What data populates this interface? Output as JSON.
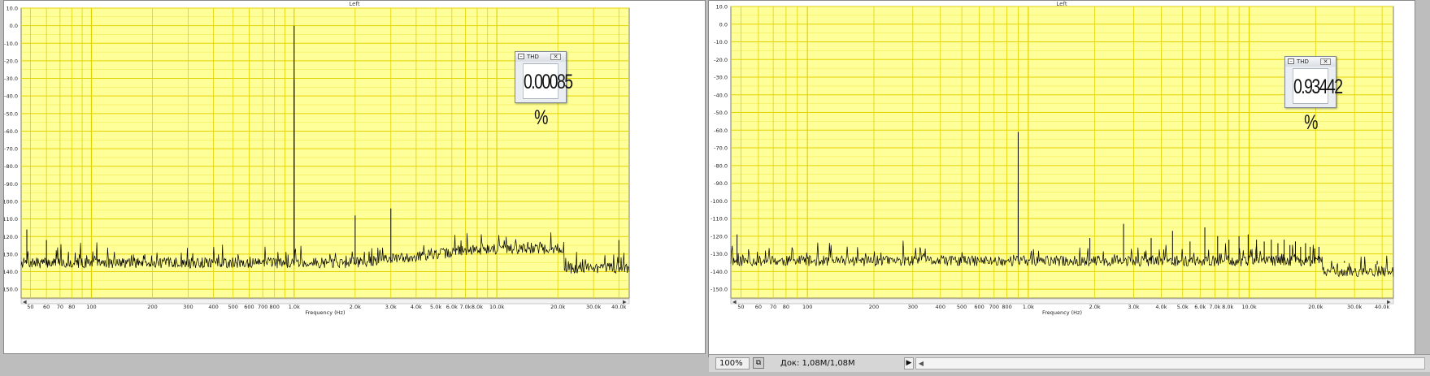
{
  "windows": [
    {
      "id": "left",
      "title": "Left",
      "thd": {
        "label": "THD",
        "value": "0.00085 %"
      },
      "chart_data": {
        "type": "line",
        "xlabel": "Frequency (Hz)",
        "ylabel": "",
        "xscale": "log",
        "xlim": [
          45,
          45000
        ],
        "ylim": [
          -155,
          10
        ],
        "grid": true,
        "yticks": [
          "10.0",
          "0.0",
          "-10.0",
          "-20.0",
          "-30.0",
          "-40.0",
          "-50.0",
          "-60.0",
          "-70.0",
          "-80.0",
          "-90.0",
          "-100.0",
          "-110.0",
          "-120.0",
          "-130.0",
          "-140.0",
          "-150.0"
        ],
        "xticks": [
          {
            "v": 50,
            "label": "50"
          },
          {
            "v": 60,
            "label": "60"
          },
          {
            "v": 70,
            "label": "70"
          },
          {
            "v": 80,
            "label": "80"
          },
          {
            "v": 100,
            "label": "100"
          },
          {
            "v": 200,
            "label": "200"
          },
          {
            "v": 300,
            "label": "300"
          },
          {
            "v": 400,
            "label": "400"
          },
          {
            "v": 500,
            "label": "500"
          },
          {
            "v": 600,
            "label": "600"
          },
          {
            "v": 700,
            "label": "700"
          },
          {
            "v": 800,
            "label": "800"
          },
          {
            "v": 1000,
            "label": "1.0k"
          },
          {
            "v": 2000,
            "label": "2.0k"
          },
          {
            "v": 3000,
            "label": "3.0k"
          },
          {
            "v": 4000,
            "label": "4.0k"
          },
          {
            "v": 5000,
            "label": "5.0k"
          },
          {
            "v": 6000,
            "label": "6.0k"
          },
          {
            "v": 7000,
            "label": "7.0k"
          },
          {
            "v": 8000,
            "label": "8.0k"
          },
          {
            "v": 10000,
            "label": "10.0k"
          },
          {
            "v": 20000,
            "label": "20.0k"
          },
          {
            "v": 30000,
            "label": "30.0k"
          },
          {
            "v": 40000,
            "label": "40.0k"
          }
        ],
        "noise": {
          "floor_low": -135,
          "floor_high": -127,
          "floor_ultrasonic": -138,
          "cutoff_hz": 21500,
          "highband_start_hz": 2000
        },
        "peaks": [
          {
            "x": 48,
            "y": -116
          },
          {
            "x": 60,
            "y": -122
          },
          {
            "x": 1000,
            "y": 0.0
          },
          {
            "x": 1000,
            "y": -31
          },
          {
            "x": 2000,
            "y": -108
          },
          {
            "x": 3000,
            "y": -104
          },
          {
            "x": 40000,
            "y": -122
          }
        ]
      }
    },
    {
      "id": "right",
      "title": "Left",
      "thd": {
        "label": "THD",
        "value": "0.93442 %"
      },
      "chart_data": {
        "type": "line",
        "xlabel": "Frequency (Hz)",
        "ylabel": "",
        "xscale": "log",
        "xlim": [
          45,
          45000
        ],
        "ylim": [
          -155,
          10
        ],
        "grid": true,
        "yticks": [
          "10.0",
          "0.0",
          "-10.0",
          "-20.0",
          "-30.0",
          "-40.0",
          "-50.0",
          "-60.0",
          "-70.0",
          "-80.0",
          "-90.0",
          "-100.0",
          "-110.0",
          "-120.0",
          "-130.0",
          "-140.0",
          "-150.0"
        ],
        "xticks": [
          {
            "v": 50,
            "label": "50"
          },
          {
            "v": 60,
            "label": "60"
          },
          {
            "v": 70,
            "label": "70"
          },
          {
            "v": 80,
            "label": "80"
          },
          {
            "v": 100,
            "label": "100"
          },
          {
            "v": 200,
            "label": "200"
          },
          {
            "v": 300,
            "label": "300"
          },
          {
            "v": 400,
            "label": "400"
          },
          {
            "v": 500,
            "label": "500"
          },
          {
            "v": 600,
            "label": "600"
          },
          {
            "v": 700,
            "label": "700"
          },
          {
            "v": 800,
            "label": "800"
          },
          {
            "v": 1000,
            "label": "1.0k"
          },
          {
            "v": 2000,
            "label": "2.0k"
          },
          {
            "v": 3000,
            "label": "3.0k"
          },
          {
            "v": 4000,
            "label": "4.0k"
          },
          {
            "v": 5000,
            "label": "5.0k"
          },
          {
            "v": 6000,
            "label": "6.0k"
          },
          {
            "v": 7000,
            "label": "7.0k"
          },
          {
            "v": 8000,
            "label": "8.0k"
          },
          {
            "v": 10000,
            "label": "10.0k"
          },
          {
            "v": 20000,
            "label": "20.0k"
          },
          {
            "v": 30000,
            "label": "30.0k"
          },
          {
            "v": 40000,
            "label": "40.0k"
          }
        ],
        "noise": {
          "floor_low": -134,
          "floor_high": -134,
          "floor_ultrasonic": -140,
          "cutoff_hz": 21500,
          "highband_start_hz": 2000
        },
        "peaks": [
          {
            "x": 48,
            "y": -119
          },
          {
            "x": 900,
            "y": -61
          },
          {
            "x": 900,
            "y": -90
          },
          {
            "x": 1900,
            "y": -121
          },
          {
            "x": 2700,
            "y": -113
          },
          {
            "x": 3600,
            "y": -121
          },
          {
            "x": 4500,
            "y": -117
          },
          {
            "x": 5400,
            "y": -123
          },
          {
            "x": 6300,
            "y": -115
          },
          {
            "x": 7200,
            "y": -120
          },
          {
            "x": 8100,
            "y": -122
          },
          {
            "x": 9000,
            "y": -120
          },
          {
            "x": 9900,
            "y": -119
          },
          {
            "x": 10800,
            "y": -122
          },
          {
            "x": 11700,
            "y": -123
          },
          {
            "x": 12600,
            "y": -122
          },
          {
            "x": 13500,
            "y": -124
          },
          {
            "x": 14400,
            "y": -122
          },
          {
            "x": 15300,
            "y": -125
          },
          {
            "x": 16200,
            "y": -123
          },
          {
            "x": 17100,
            "y": -126
          },
          {
            "x": 18000,
            "y": -124
          },
          {
            "x": 18900,
            "y": -126
          },
          {
            "x": 19800,
            "y": -127
          },
          {
            "x": 20700,
            "y": -126
          },
          {
            "x": 27000,
            "y": -135
          },
          {
            "x": 38000,
            "y": -136
          }
        ]
      }
    }
  ],
  "statusbar": {
    "zoom": "100%",
    "doc": "Док: 1,08M/1,08M",
    "play_icon": "play-icon"
  },
  "colors": {
    "plot_bg": "#ffff99",
    "grid": "#e2d200",
    "trace": "#000000"
  }
}
